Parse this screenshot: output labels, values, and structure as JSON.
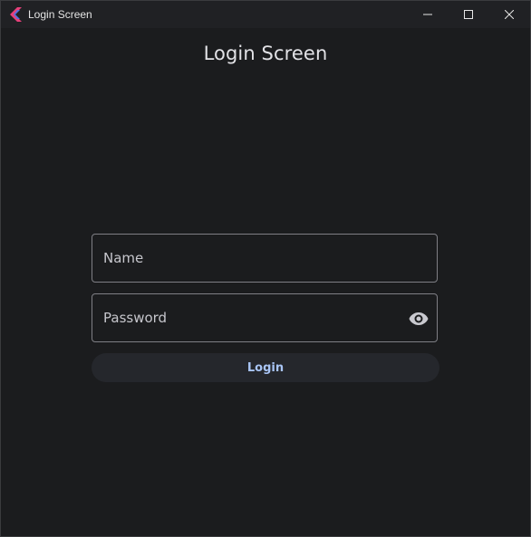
{
  "window": {
    "title": "Login Screen"
  },
  "page": {
    "title": "Login Screen"
  },
  "form": {
    "name_placeholder": "Name",
    "name_value": "",
    "password_placeholder": "Password",
    "password_value": "",
    "visibility_icon": "eye-icon",
    "login_label": "Login"
  },
  "colors": {
    "background": "#1b1c1e",
    "titlebar": "#202124",
    "field_border": "#7f7f85",
    "button_bg": "#25272c",
    "button_text": "#a9c5f5",
    "app_icon_primary": "#e8407a",
    "app_icon_secondary": "#5a6fe0"
  }
}
